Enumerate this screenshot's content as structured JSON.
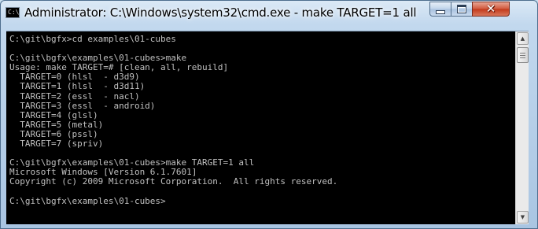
{
  "window": {
    "title": "Administrator: C:\\Windows\\system32\\cmd.exe - make  TARGET=1 all",
    "icon": "cmd-icon",
    "icon_text": "C:\\"
  },
  "controls": {
    "minimize_icon": "minimize-icon",
    "maximize_icon": "maximize-icon",
    "close_icon": "close-icon",
    "close_glyph": "✕"
  },
  "console": {
    "lines": [
      "C:\\git\\bgfx>cd examples\\01-cubes",
      "",
      "C:\\git\\bgfx\\examples\\01-cubes>make",
      "Usage: make TARGET=# [clean, all, rebuild]",
      "  TARGET=0 (hlsl  - d3d9)",
      "  TARGET=1 (hlsl  - d3d11)",
      "  TARGET=2 (essl  - nacl)",
      "  TARGET=3 (essl  - android)",
      "  TARGET=4 (glsl)",
      "  TARGET=5 (metal)",
      "  TARGET=6 (pssl)",
      "  TARGET=7 (spriv)",
      "",
      "C:\\git\\bgfx\\examples\\01-cubes>make TARGET=1 all",
      "Microsoft Windows [Version 6.1.7601]",
      "Copyright (c) 2009 Microsoft Corporation.  All rights reserved.",
      "",
      "C:\\git\\bgfx\\examples\\01-cubes>"
    ]
  },
  "scrollbar": {
    "up_glyph": "▲",
    "down_glyph": "▼",
    "position": 0.0
  },
  "colors": {
    "console_bg": "#000000",
    "console_fg": "#c0c0c0",
    "close_button": "#c2381a"
  }
}
